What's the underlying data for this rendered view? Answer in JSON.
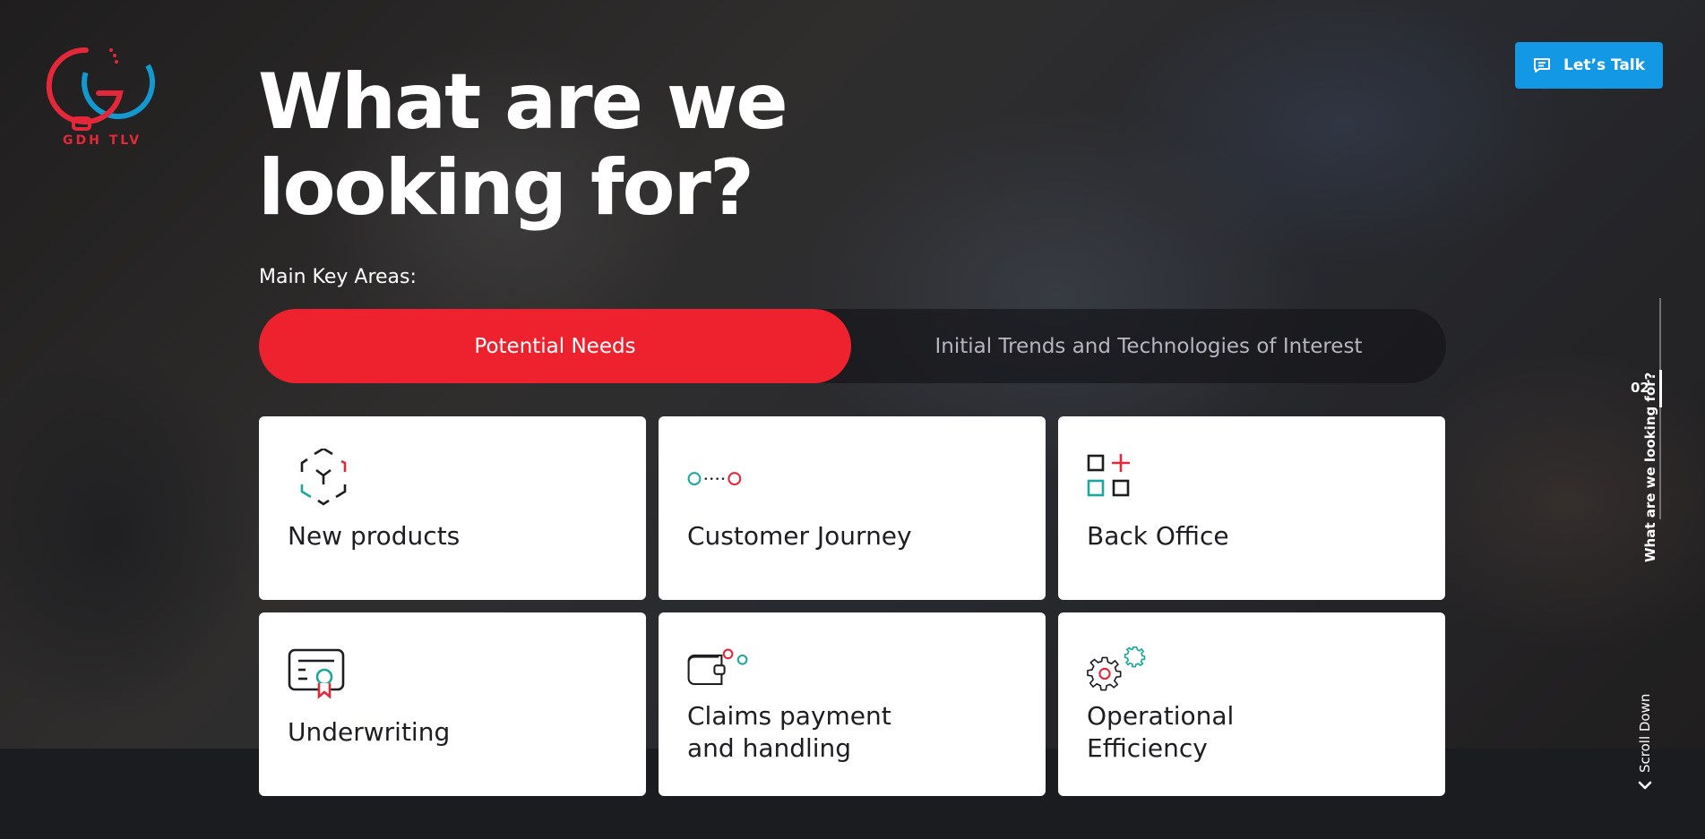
{
  "logo": {
    "text": "GDH TLV",
    "icon": "gdh-logo-icon"
  },
  "cta": {
    "label": "Let’s Talk",
    "icon": "chat-icon"
  },
  "hero": {
    "title_line1": "What are we",
    "title_line2": "looking for?",
    "subtitle": "Main Key Areas:"
  },
  "tabs": [
    {
      "label": "Potential Needs",
      "active": true
    },
    {
      "label": "Initial Trends and Technologies of Interest",
      "active": false
    }
  ],
  "cards": [
    {
      "label": "New products",
      "icon": "cube-icon"
    },
    {
      "label": "Customer Journey",
      "icon": "journey-dots-icon"
    },
    {
      "label": "Back Office",
      "icon": "grid-plus-icon"
    },
    {
      "label": "Underwriting",
      "icon": "certificate-icon"
    },
    {
      "label_line1": "Claims payment",
      "label_line2": "and handling",
      "icon": "wallet-icon"
    },
    {
      "label_line1": "Operational",
      "label_line2": "Efficiency",
      "icon": "gears-icon"
    }
  ],
  "side_nav": {
    "number": "02",
    "label": "What are we looking for?"
  },
  "scroll": {
    "label": "Scroll Down",
    "icon": "chevron-down-icon"
  },
  "colors": {
    "accent_red": "#ee222e",
    "cta_blue": "#1398e6",
    "teal": "#1aa99a",
    "dark": "#1b1c20"
  }
}
